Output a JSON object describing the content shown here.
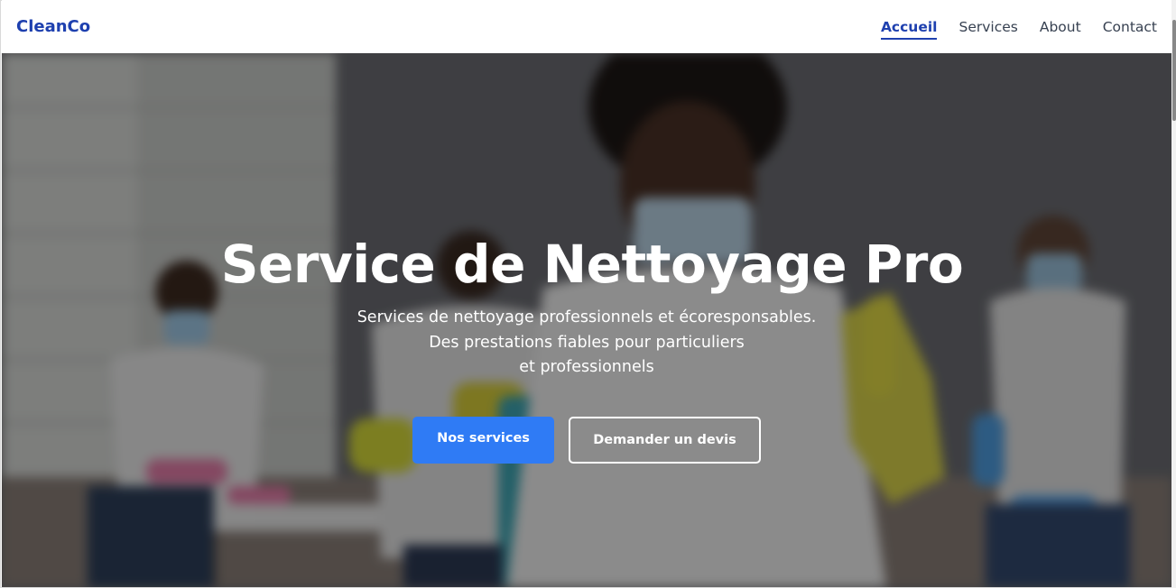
{
  "brand": {
    "name": "CleanCo"
  },
  "nav": {
    "items": [
      {
        "label": "Accueil",
        "active": true
      },
      {
        "label": "Services",
        "active": false
      },
      {
        "label": "About",
        "active": false
      },
      {
        "label": "Contact",
        "active": false
      }
    ]
  },
  "hero": {
    "title": "Service de Nettoyage Pro",
    "subtitle_lines": [
      "Services de nettoyage professionnels et écoresponsables.",
      "Des prestations fiables pour particuliers",
      "et professionnels"
    ],
    "primary_button": "Nos services",
    "secondary_button": "Demander un devis"
  },
  "colors": {
    "brand": "#1e40af",
    "primary_button": "#2f7bf5",
    "overlay": "#000000"
  },
  "icons": {
    "scrollbar": "scrollbar-thumb"
  }
}
